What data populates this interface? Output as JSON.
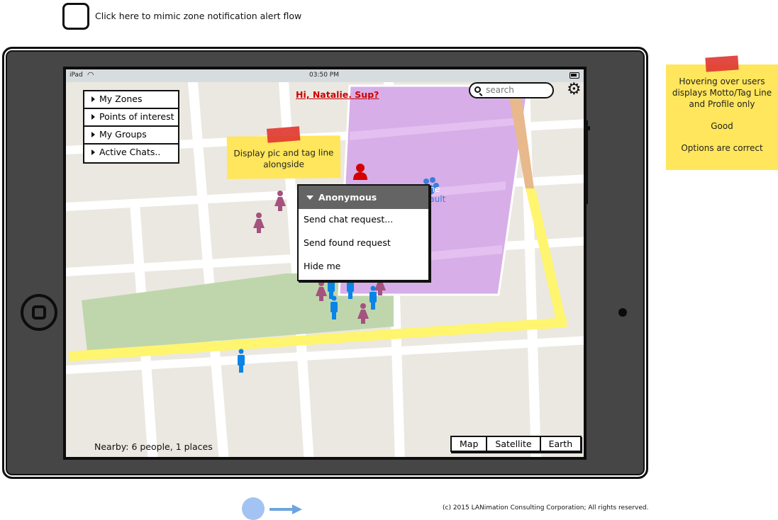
{
  "header": {
    "checkbox_label": "Click here to mimic zone notification alert flow"
  },
  "statusbar": {
    "device": "iPad",
    "wifi_icon": "wifi-icon",
    "time": "03:50 PM",
    "battery_icon": "battery-icon"
  },
  "side_menu": {
    "items": [
      {
        "label": "My Zones"
      },
      {
        "label": "Points of interest"
      },
      {
        "label": "My Groups"
      },
      {
        "label": "Active Chats.."
      }
    ]
  },
  "greeting": "Hi, Natalie. Sup?",
  "search": {
    "placeholder": "search",
    "icon": "search-icon"
  },
  "settings_icon": "gear-icon",
  "sticky_inner": {
    "text": "Display pic and tag line alongside"
  },
  "zone": {
    "label_line1": "one",
    "label_line2": "Vault",
    "color": "#d7aee8"
  },
  "popup": {
    "header": "Anonymous",
    "options": [
      {
        "label": "Send chat request..."
      },
      {
        "label": "Send found request"
      },
      {
        "label": "Hide me"
      }
    ]
  },
  "nearby": "Nearby: 6 people, 1 places",
  "map_types": [
    {
      "label": "Map"
    },
    {
      "label": "Satellite"
    },
    {
      "label": "Earth"
    }
  ],
  "sticky_right": {
    "line1": "Hovering over users displays Motto/Tag Line and Profile only",
    "line2": "Good",
    "line3": "Options are correct"
  },
  "footer": {
    "copyright": "(c) 2015 LANimation Consulting Corporation; All rights reserved."
  },
  "colors": {
    "female_marker": "#a4527e",
    "male_marker": "#0a84e6",
    "user_marker": "#d40000",
    "highlight_road": "#fff56e",
    "park": "#bfd6ad"
  }
}
